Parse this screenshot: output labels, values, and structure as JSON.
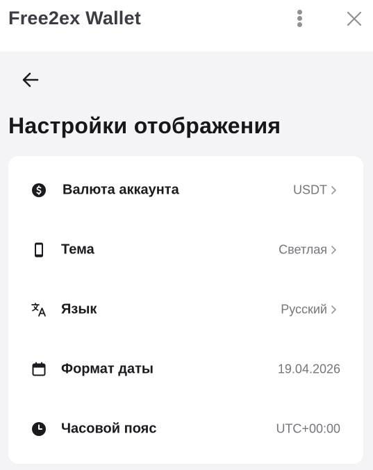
{
  "app": {
    "title": "Free2ex Wallet",
    "menu_icon": "more-vertical-icon",
    "close_icon": "close-icon"
  },
  "page": {
    "back_icon": "arrow-left-icon",
    "title": "Настройки отображения"
  },
  "settings": [
    {
      "icon": "currency-coin-icon",
      "label": "Валюта аккаунта",
      "value": "USDT",
      "chevron": true
    },
    {
      "icon": "smartphone-icon",
      "label": "Тема",
      "value": "Светлая",
      "chevron": true
    },
    {
      "icon": "translate-icon",
      "label": "Язык",
      "value": "Русский",
      "chevron": true
    },
    {
      "icon": "calendar-icon",
      "label": "Формат даты",
      "value": "19.04.2026",
      "chevron": false
    },
    {
      "icon": "clock-icon",
      "label": "Часовой пояс",
      "value": "UTC+00:00",
      "chevron": false
    }
  ],
  "colors": {
    "background": "#f4f4f7",
    "card": "#ffffff",
    "text_primary": "#1b1b1f",
    "text_secondary": "#75757c"
  }
}
